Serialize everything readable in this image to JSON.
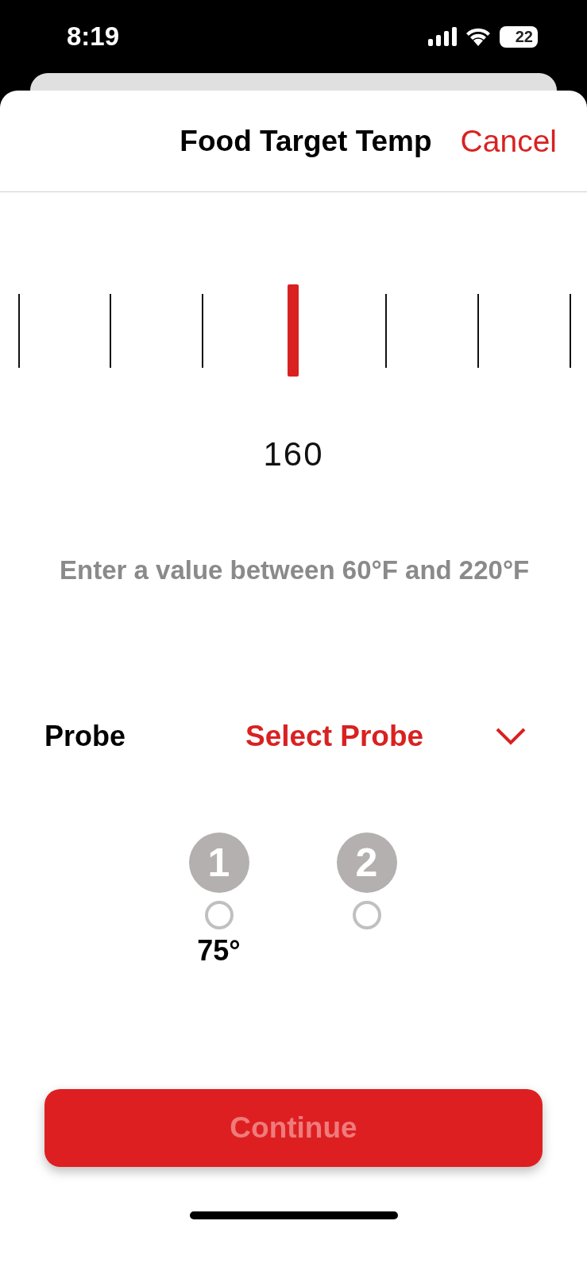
{
  "status_bar": {
    "time": "8:19",
    "battery": "22"
  },
  "header": {
    "title": "Food Target Temp",
    "cancel": "Cancel"
  },
  "value": "160",
  "hint": "Enter a value between 60°F and 220°F",
  "probe_row": {
    "label": "Probe",
    "value": "Select Probe"
  },
  "probes": [
    {
      "number": "1",
      "selected": false,
      "reading": "75°"
    },
    {
      "number": "2",
      "selected": false
    }
  ],
  "continue_button": {
    "label": "Continue",
    "disabled": true
  }
}
